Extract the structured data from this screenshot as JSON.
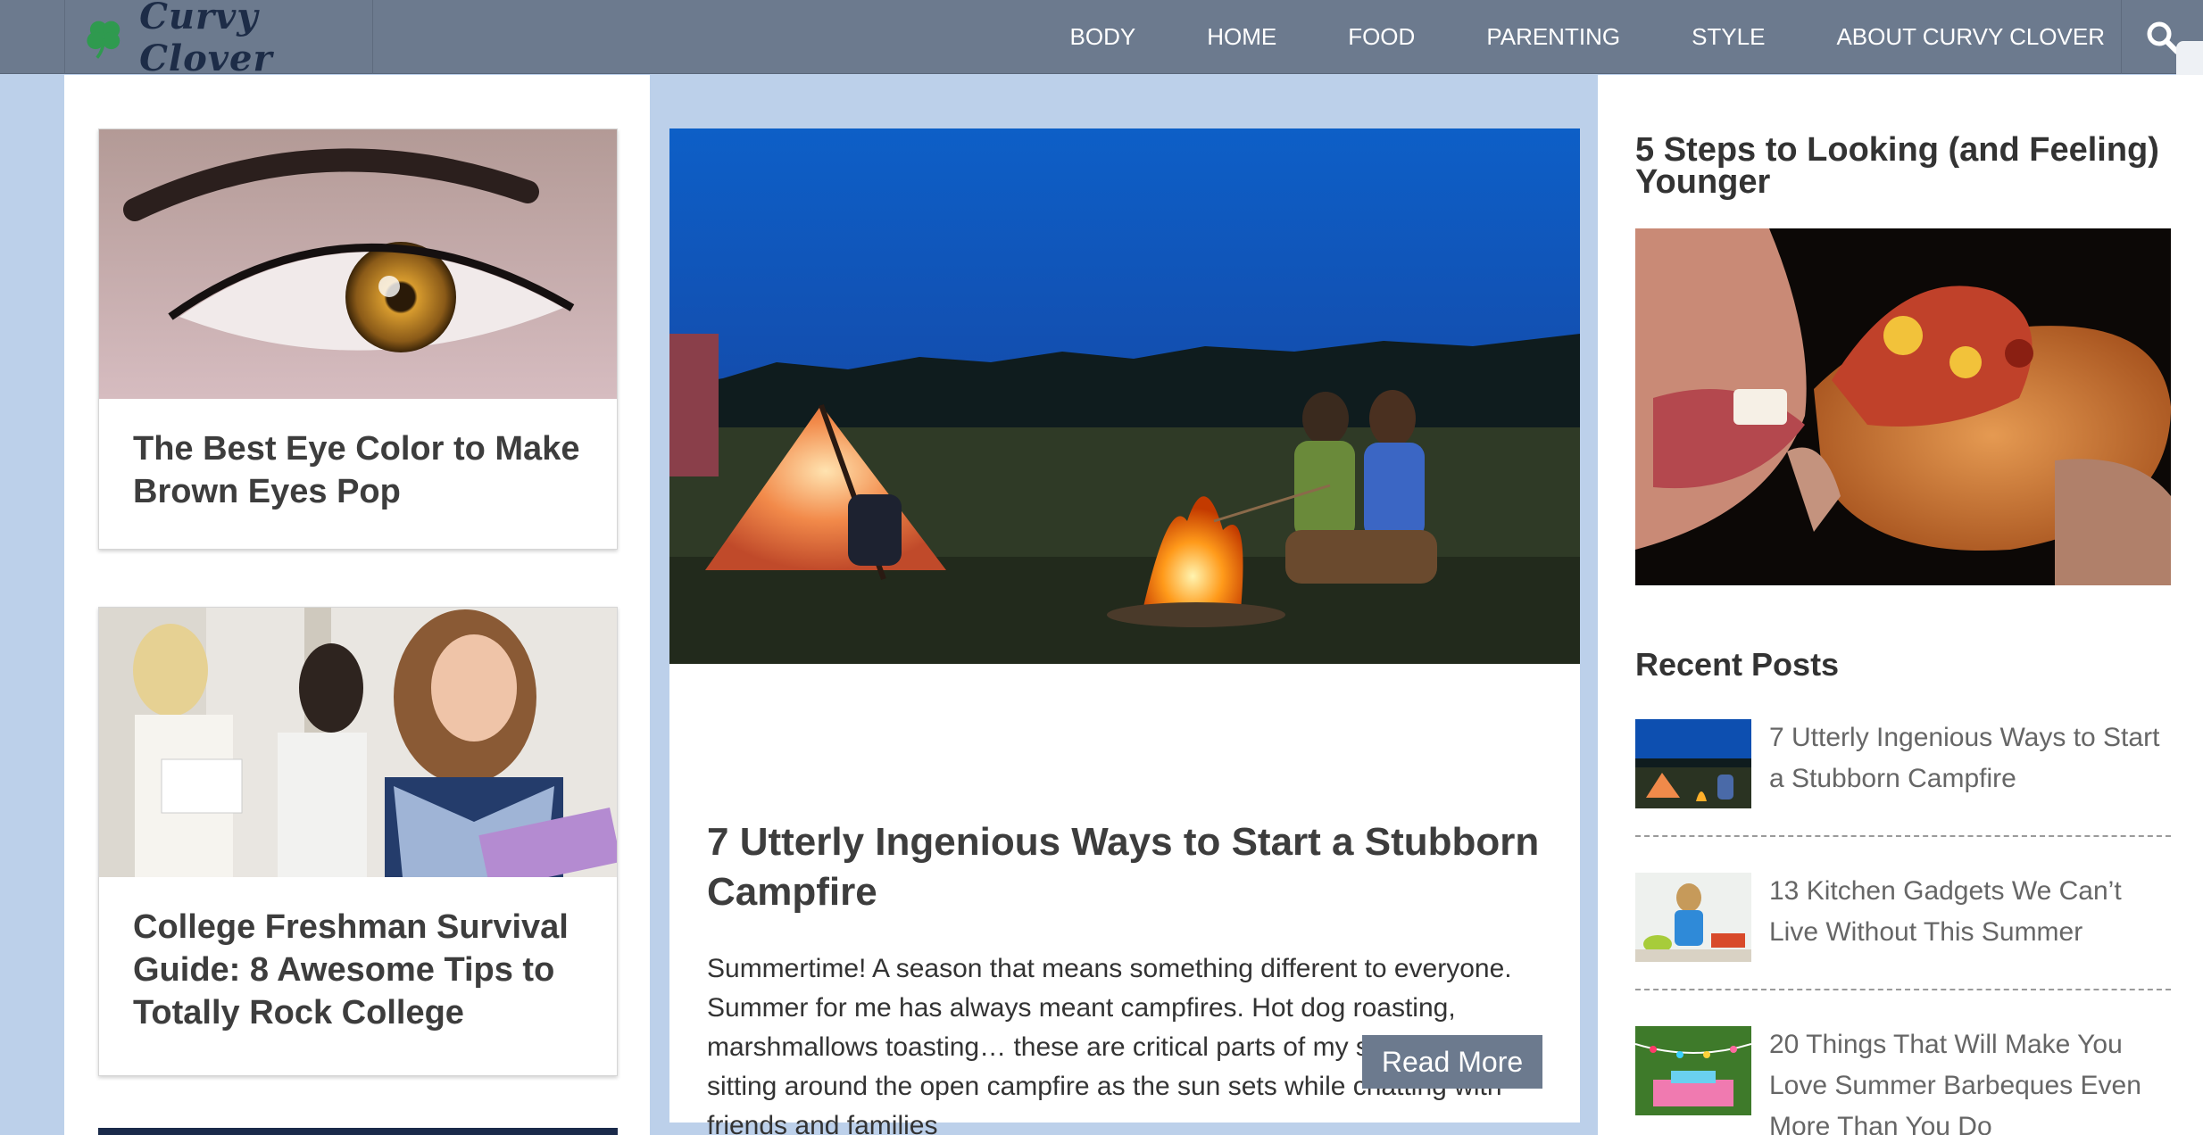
{
  "site": {
    "logo_text": "Curvy Clover"
  },
  "nav": {
    "items": [
      {
        "label": "BODY"
      },
      {
        "label": "HOME"
      },
      {
        "label": "FOOD"
      },
      {
        "label": "PARENTING"
      },
      {
        "label": "STYLE"
      },
      {
        "label": "ABOUT CURVY CLOVER"
      }
    ],
    "search_icon": "search-icon"
  },
  "left_cards": [
    {
      "title": "The Best Eye Color to Make Brown Eyes Pop",
      "image": "brown-eye-photo"
    },
    {
      "title": "College Freshman Survival Guide: 8 Awesome Tips to Totally Rock College",
      "image": "college-students-photo"
    }
  ],
  "feature": {
    "image": "campfire-tent-photo",
    "title": "7 Utterly Ingenious Ways to Start a Stubborn Campfire",
    "excerpt": "Summertime!  A season that means something different to everyone.  Summer for me has always meant campfires.  Hot dog roasting, marshmallows toasting… these are critical parts of my summer.  And sitting around the open campfire as the sun sets while chatting with friends and families",
    "read_more_label": "Read More"
  },
  "sidebar": {
    "featured_title": "5 Steps to Looking (and Feeling) Younger",
    "featured_image": "pizza-bite-photo",
    "recent_heading": "Recent Posts",
    "recent_posts": [
      {
        "title": "7 Utterly Ingenious Ways to Start a Stubborn Campfire",
        "thumb": "campfire-thumb"
      },
      {
        "title": "13 Kitchen Gadgets We Can’t Live Without This Summer",
        "thumb": "kitchen-thumb"
      },
      {
        "title": "20 Things That Will Make You Love Summer Barbeques Even More Than You Do",
        "thumb": "barbeque-thumb"
      }
    ]
  },
  "colors": {
    "nav_bg": "#6c7a8e",
    "page_bg": "#bcd0ea",
    "logo_green": "#2f9a4f",
    "logo_navy": "#1d2c47",
    "button_bg": "#6c7a8e"
  }
}
